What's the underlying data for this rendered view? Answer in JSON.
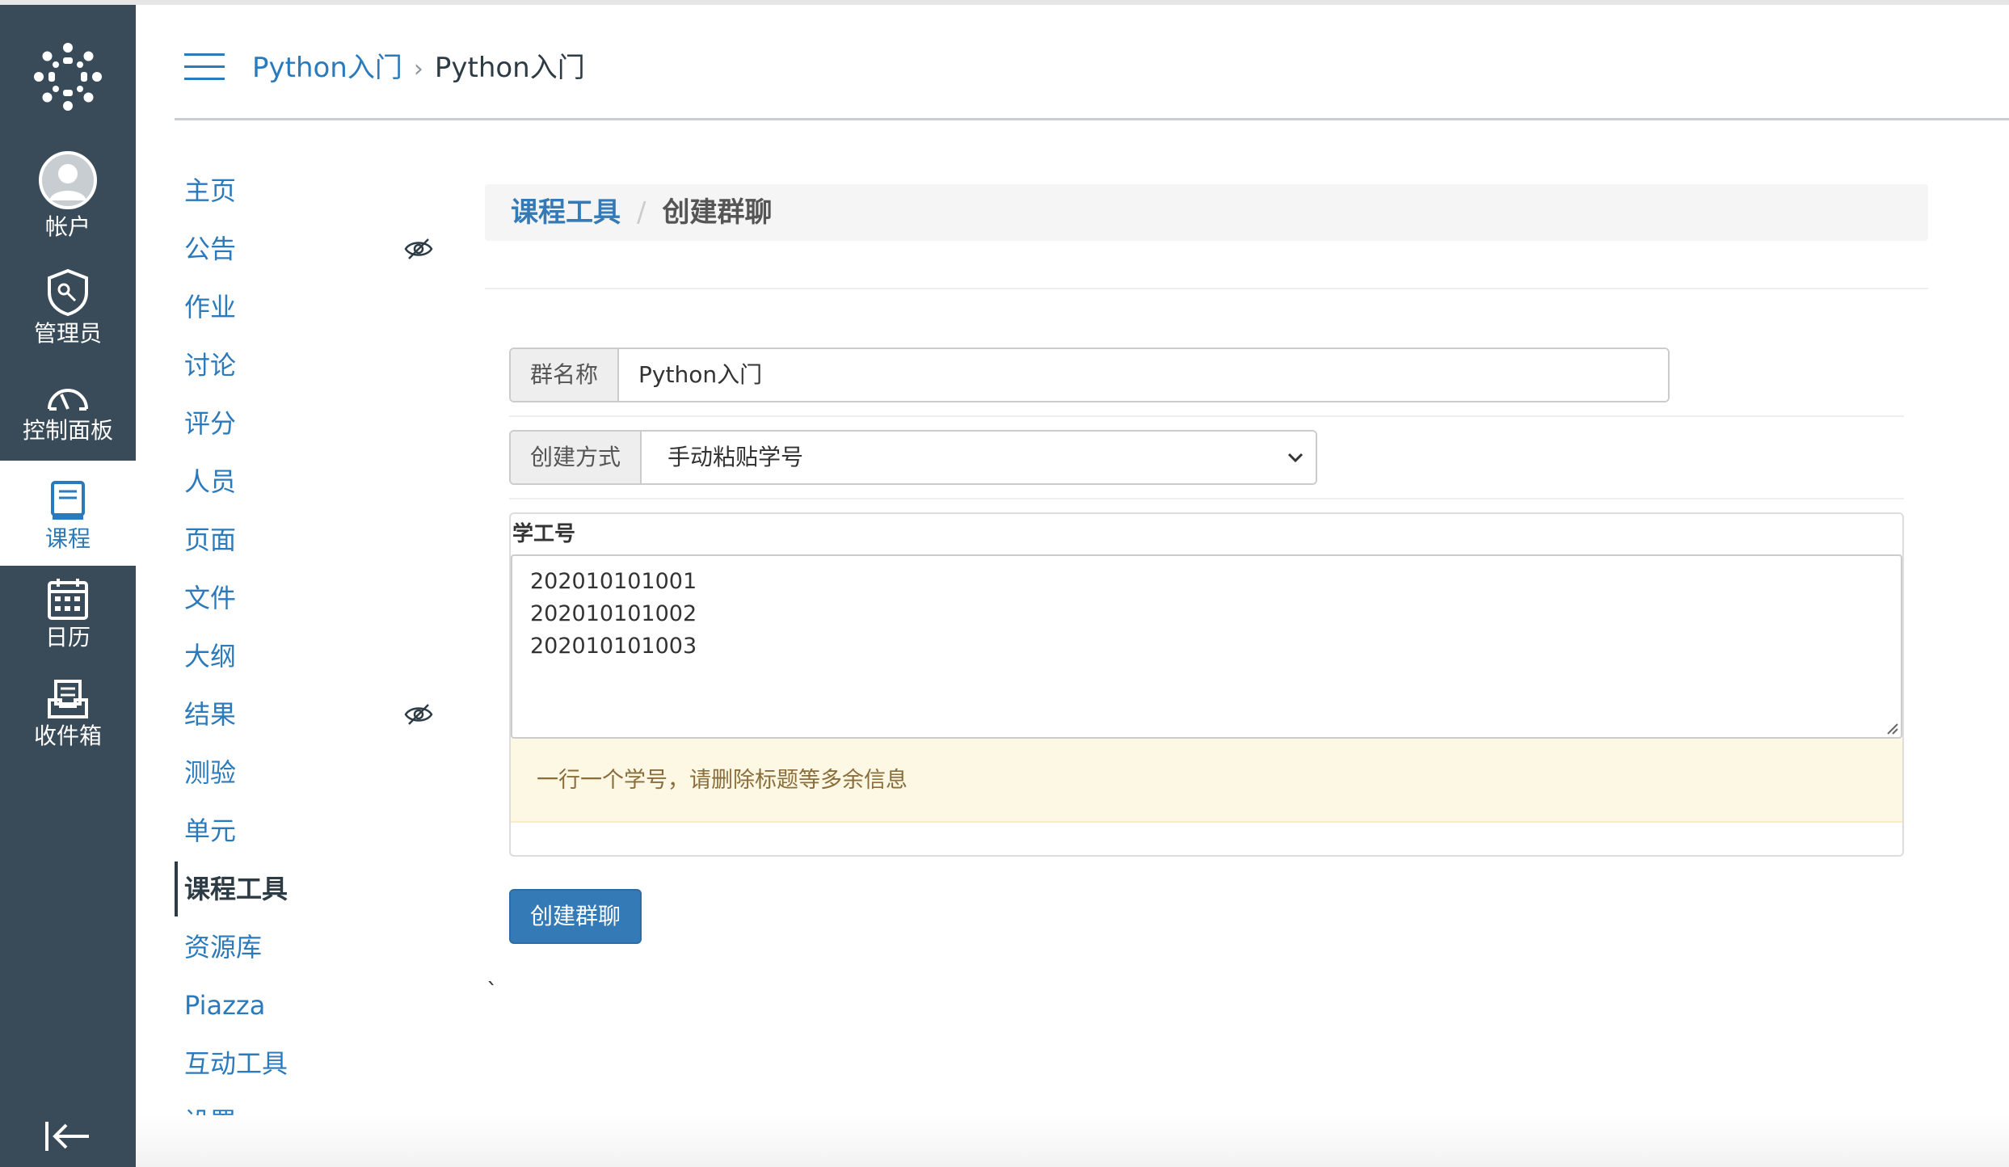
{
  "global_nav": {
    "account": "帐户",
    "admin": "管理员",
    "dashboard": "控制面板",
    "courses": "课程",
    "calendar": "日历",
    "inbox": "收件箱"
  },
  "header": {
    "crumb_course": "Python入门",
    "crumb_separator": "›",
    "crumb_current": "Python入门"
  },
  "course_nav": {
    "items": [
      {
        "label": "主页",
        "hidden": false
      },
      {
        "label": "公告",
        "hidden": true
      },
      {
        "label": "作业",
        "hidden": false
      },
      {
        "label": "讨论",
        "hidden": false
      },
      {
        "label": "评分",
        "hidden": false
      },
      {
        "label": "人员",
        "hidden": false
      },
      {
        "label": "页面",
        "hidden": false
      },
      {
        "label": "文件",
        "hidden": false
      },
      {
        "label": "大纲",
        "hidden": false
      },
      {
        "label": "结果",
        "hidden": true
      },
      {
        "label": "测验",
        "hidden": false
      },
      {
        "label": "单元",
        "hidden": false
      },
      {
        "label": "课程工具",
        "hidden": false,
        "active": true
      },
      {
        "label": "资源库",
        "hidden": false
      },
      {
        "label": "Piazza",
        "hidden": false
      },
      {
        "label": "互动工具",
        "hidden": false
      },
      {
        "label": "设置",
        "hidden": false
      }
    ]
  },
  "main": {
    "breadcrumb_link": "课程工具",
    "breadcrumb_separator": "/",
    "breadcrumb_current": "创建群聊",
    "group_name_label": "群名称",
    "group_name_value": "Python入门",
    "method_label": "创建方式",
    "method_selected": "手动粘贴学号",
    "ids_title": "学工号",
    "ids": [
      "202010101001",
      "202010101002",
      "202010101003"
    ],
    "hint": "一行一个学号，请删除标题等多余信息",
    "submit": "创建群聊",
    "stray_char": "`"
  },
  "colors": {
    "nav_bg": "#394b58",
    "link": "#2b7abc",
    "primary": "#337ab7",
    "alert_bg": "#fcf8e3",
    "alert_text": "#8a6d3b"
  }
}
